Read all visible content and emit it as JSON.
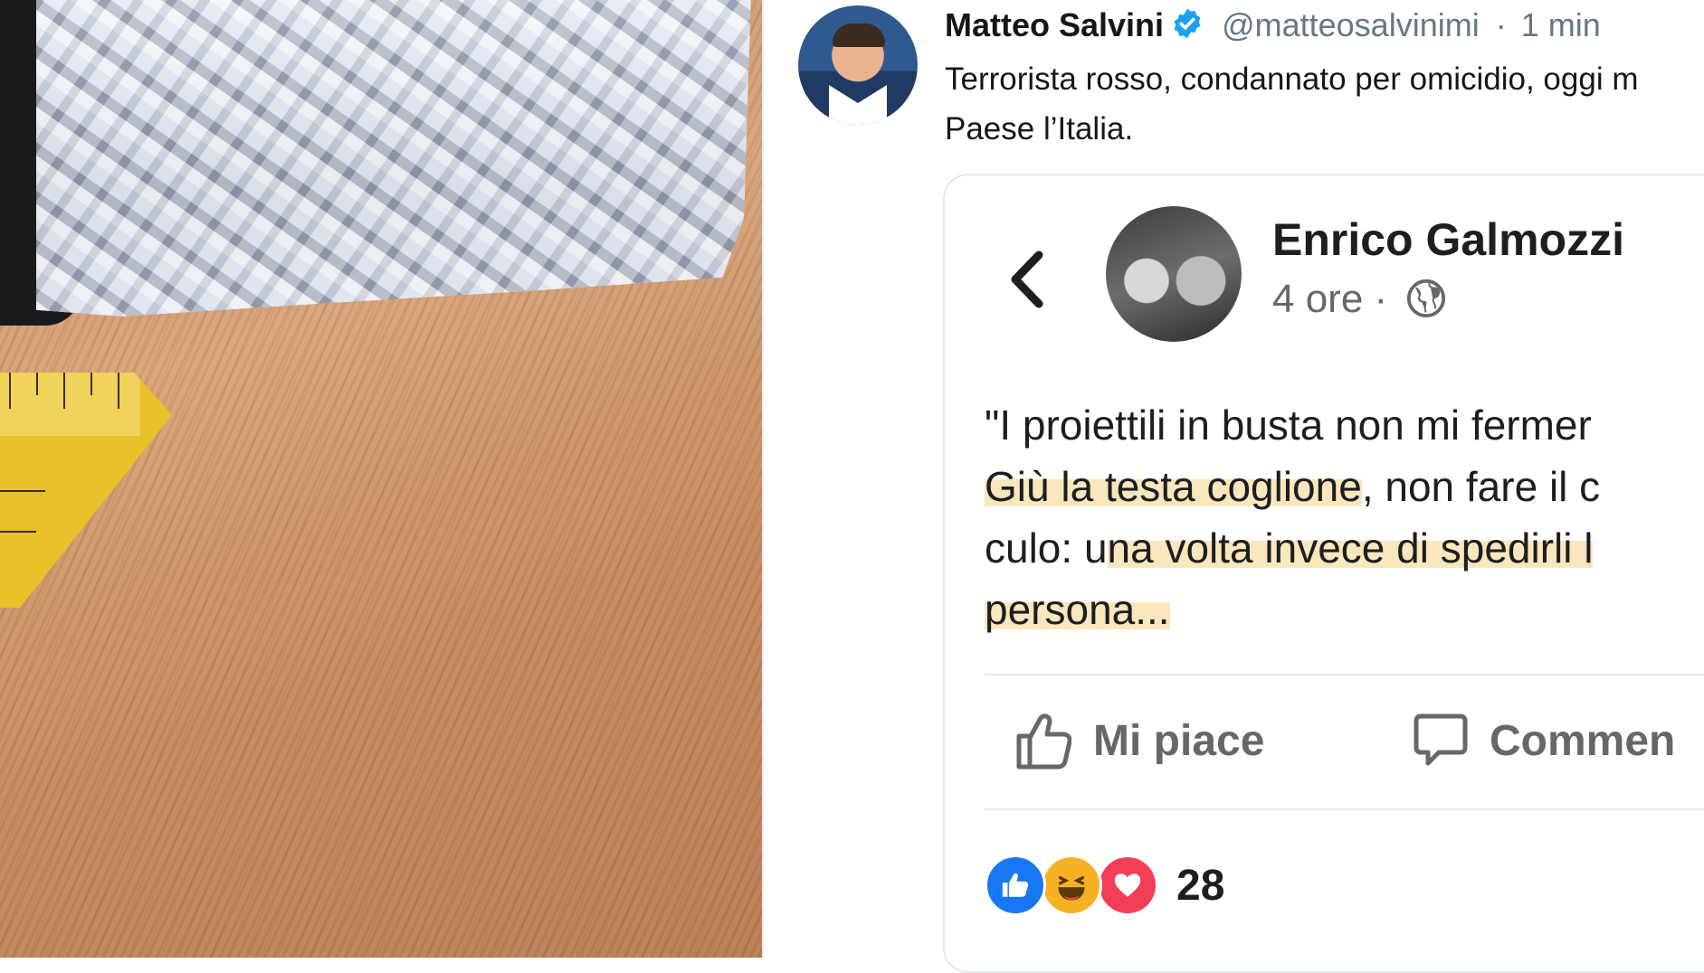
{
  "tweet": {
    "author_name": "Matteo Salvini",
    "handle": "@matteosalvinimi",
    "time_separator": "·",
    "time": "1 min",
    "text": "Terrorista rosso, condannato per omicidio, oggi m Paese l’Italia."
  },
  "embedded_post": {
    "author_name": "Enrico Galmozzi",
    "time": "4 ore",
    "meta_separator": "·",
    "text_lines": [
      "\"I proiettili in busta non mi fermer",
      "Giù la testa coglione",
      ", non fare il c",
      "culo: u",
      "na volta invece di spedirli l",
      "persona..."
    ],
    "like_label": "Mi piace",
    "comment_label": "Commen",
    "reaction_count": "28"
  },
  "colors": {
    "twitter_blue": "#1da1f2",
    "fb_blue": "#1877f2",
    "highlight": "#fbe7bd"
  },
  "icons": [
    "verified-badge-icon",
    "chevron-left-icon",
    "globe-icon",
    "thumbs-up-icon",
    "comment-bubble-icon",
    "like-reaction-icon",
    "haha-reaction-icon",
    "love-reaction-icon"
  ]
}
